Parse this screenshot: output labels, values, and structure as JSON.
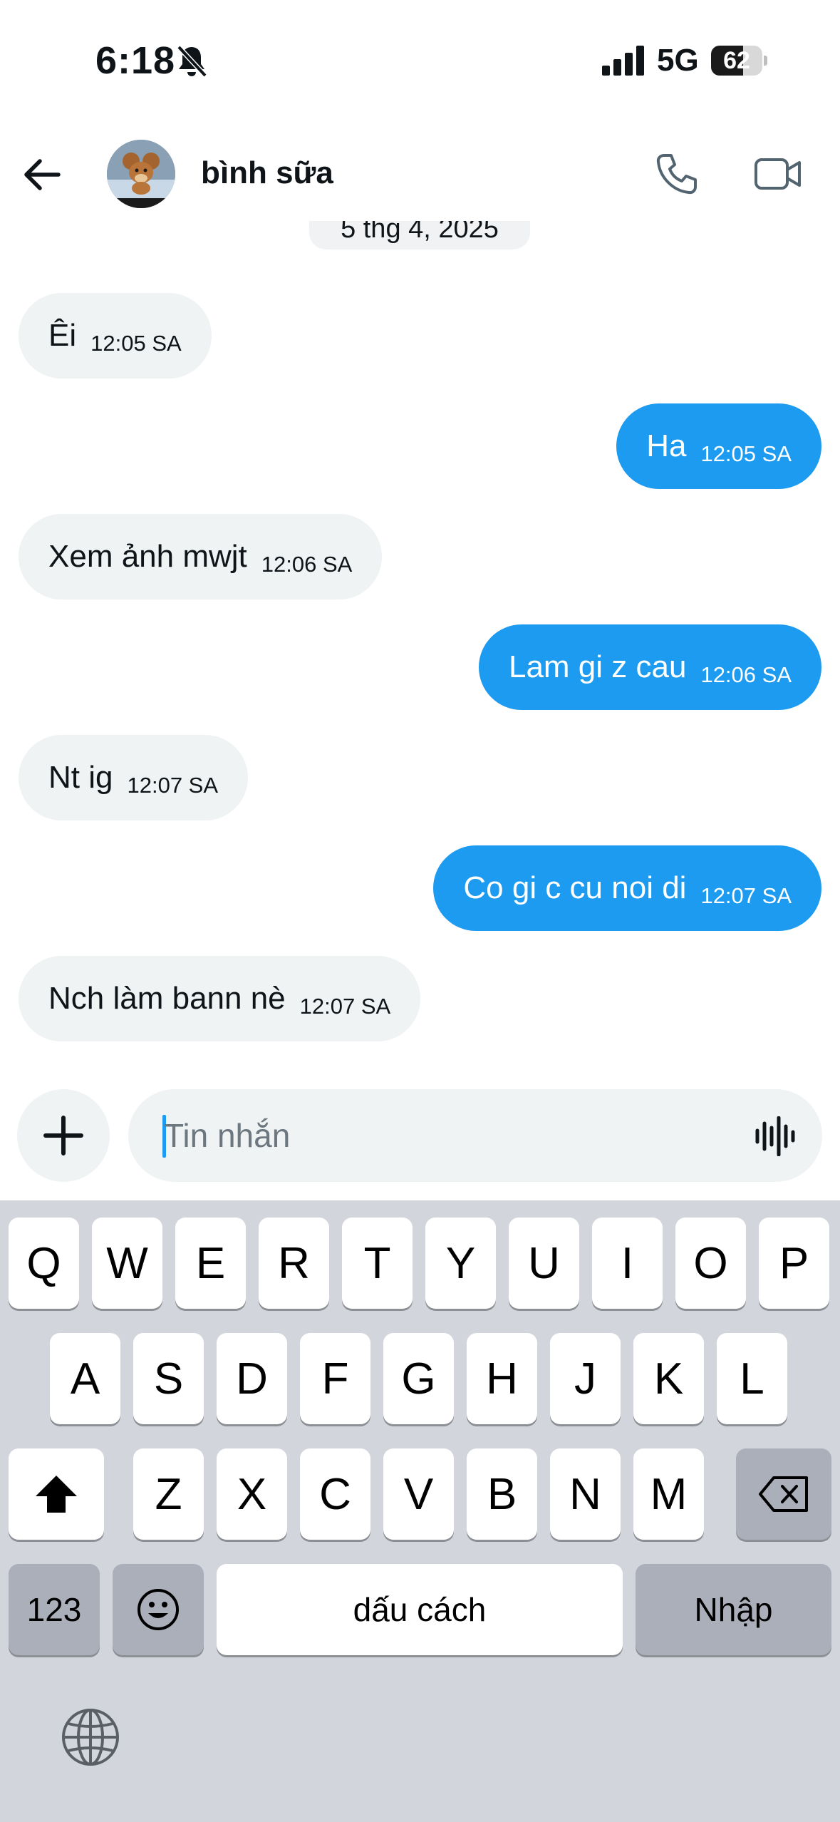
{
  "status_bar": {
    "time": "6:18",
    "network": "5G",
    "battery_level": 62,
    "battery_text": "62",
    "icons": [
      "bell-muted-icon",
      "cellular-signal-icon",
      "battery-icon"
    ]
  },
  "header": {
    "contact_name": "bình sữa",
    "icons": [
      "back-arrow-icon",
      "phone-icon",
      "video-camera-icon"
    ]
  },
  "conversation": {
    "date": "5 thg 4, 2025",
    "messages": [
      {
        "direction": "in",
        "text": "Êi",
        "time": "12:05 SA"
      },
      {
        "direction": "out",
        "text": "Ha",
        "time": "12:05 SA"
      },
      {
        "direction": "in",
        "text": "Xem ảnh mwjt",
        "time": "12:06 SA"
      },
      {
        "direction": "out",
        "text": "Lam gi z cau",
        "time": "12:06 SA"
      },
      {
        "direction": "in",
        "text": "Nt ig",
        "time": "12:07 SA"
      },
      {
        "direction": "out",
        "text": "Co gi c cu noi di",
        "time": "12:07 SA"
      },
      {
        "direction": "in",
        "text": "Nch làm bann nè",
        "time": "12:07 SA"
      }
    ]
  },
  "composer": {
    "placeholder": "Tin nhắn",
    "icons": [
      "plus-icon",
      "voice-wave-icon"
    ]
  },
  "keyboard": {
    "row1": [
      "Q",
      "W",
      "E",
      "R",
      "T",
      "Y",
      "U",
      "I",
      "O",
      "P"
    ],
    "row2": [
      "A",
      "S",
      "D",
      "F",
      "G",
      "H",
      "J",
      "K",
      "L"
    ],
    "row3": [
      "Z",
      "X",
      "C",
      "V",
      "B",
      "N",
      "M"
    ],
    "numbers_label": "123",
    "space_label": "dấu cách",
    "return_label": "Nhập",
    "icons": [
      "shift-icon",
      "backspace-icon",
      "emoji-icon",
      "globe-icon"
    ]
  },
  "colors": {
    "accent": "#1d9bf0",
    "incoming_bubble": "#eff3f4",
    "keyboard_bg": "#d3d5dc"
  }
}
